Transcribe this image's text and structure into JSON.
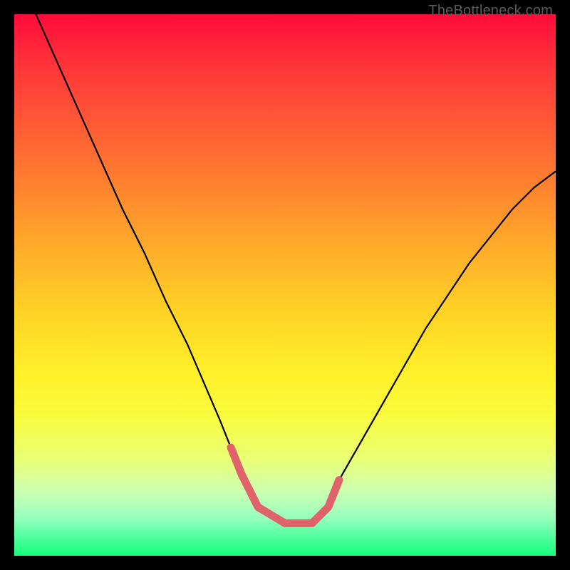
{
  "watermark": {
    "text": "TheBottleneck.com"
  },
  "colors": {
    "curve_main": "#000000",
    "curve_highlight": "#e0636c",
    "gradient_top": "#ff0a3a",
    "gradient_bottom": "#16ff79"
  },
  "chart_data": {
    "type": "line",
    "title": "",
    "xlabel": "",
    "ylabel": "",
    "xlim": [
      0,
      100
    ],
    "ylim": [
      0,
      100
    ],
    "grid": false,
    "legend": false,
    "annotations": [
      "TheBottleneck.com"
    ],
    "note": "Axes have no tick labels; x normalized 0–100 left→right, y normalized 0–100 bottom→top. Values estimated from pixel positions.",
    "series": [
      {
        "name": "main-curve",
        "color": "#000000",
        "x": [
          4,
          8,
          12,
          16,
          20,
          24,
          28,
          32,
          35,
          38,
          40,
          42,
          45,
          50,
          55,
          58,
          60,
          64,
          68,
          72,
          76,
          80,
          84,
          88,
          92,
          96,
          100
        ],
        "y": [
          100,
          91,
          82,
          73,
          64,
          56,
          47,
          39,
          32,
          25,
          20,
          15,
          9,
          6,
          6,
          9,
          14,
          21,
          28,
          35,
          42,
          48,
          54,
          59,
          64,
          68,
          71
        ]
      },
      {
        "name": "highlight-segment",
        "color": "#e0636c",
        "x": [
          40,
          42,
          45,
          50,
          55,
          58,
          60
        ],
        "y": [
          20,
          15,
          9,
          6,
          6,
          9,
          14
        ]
      }
    ]
  }
}
